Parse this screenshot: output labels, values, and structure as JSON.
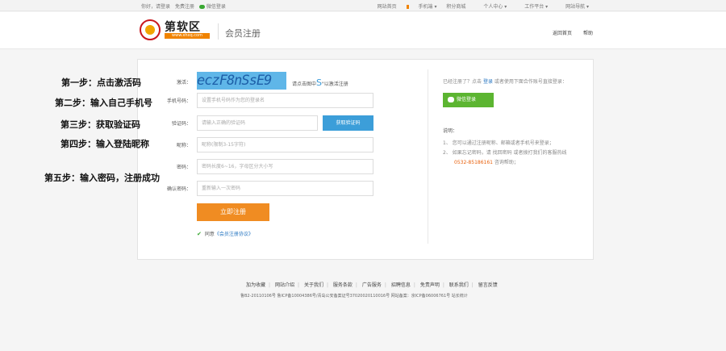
{
  "topbar": {
    "greeting": "你好，请登录",
    "register": "免费注册",
    "wechat_login": "微信登录",
    "links": [
      "网站首页",
      "手机端",
      "积分商城",
      "个人中心",
      "工作平台",
      "网站导航"
    ]
  },
  "header": {
    "logo_name": "第软区",
    "logo_url": "www.xhxq.com",
    "page_title": "会员注册",
    "nav": [
      "返回首页",
      "帮助"
    ]
  },
  "form": {
    "activate_label": "激活：",
    "captcha_text": "eczF8nSsE9",
    "captcha_tip_pre": "请点击图中",
    "captcha_tip_char": "S",
    "captcha_tip_post": "\"以激活注册",
    "phone_label": "手机号码：",
    "phone_placeholder": "设置手机号码作为您的登录名",
    "code_label": "验证码：",
    "code_placeholder": "请输入正确的验证码",
    "code_button": "获取验证码",
    "nick_label": "昵称：",
    "nick_placeholder": "昵称(限制3-15字符)",
    "pwd_label": "密码：",
    "pwd_placeholder": "密码长度6~16，字母区分大小写",
    "pwd2_label": "确认密码：",
    "pwd2_placeholder": "重新输入一次密码",
    "submit": "立即注册",
    "agree_text": "同意",
    "agree_link": "《会员注册协议》"
  },
  "side": {
    "registered_pre": "已经注册了？点击",
    "login_link": "登录",
    "registered_post": "或者使用下面合作账号直接登录：",
    "wechat_button": "微信登录",
    "notes_title": "说明：",
    "note1": "1、 您可以通过注册昵称、邮箱或者手机号来登录；",
    "note2": "2、 如果忘记密码，请 找回密码 或者拨打我们的客服热线",
    "phone": "0532-85186161",
    "phone_suffix": "咨询帮助；"
  },
  "steps": [
    "第一步：点击激活码",
    "第二步：输入自己手机号",
    "第三步：获取验证码",
    "第四步：输入登陆昵称",
    "第五步：输入密码，注册成功"
  ],
  "footer": {
    "links": [
      "加为收藏",
      "网站介绍",
      "关于我们",
      "服务条款",
      "广告服务",
      "招聘信息",
      "免责声明",
      "联系我们",
      "留言反馈"
    ],
    "copyright": "鲁B2-20110106号 鲁ICP备10004386号/青岛公安备案证号37020020110016号     网站备案：京ICP备06006761号 站长统计"
  }
}
